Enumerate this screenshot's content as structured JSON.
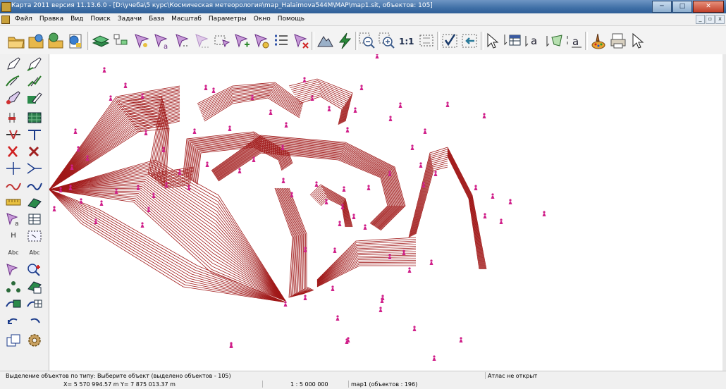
{
  "window": {
    "title": "Карта 2011 версия 11.13.6.0 - [D:\\учеба\\5 курс\\Космическая метеорология\\map_Halaimova544M\\MAP\\map1.sit, объектов: 105]",
    "min": "─",
    "max": "□",
    "close": "✕"
  },
  "menubar": {
    "items": [
      "Файл",
      "Правка",
      "Вид",
      "Поиск",
      "Задачи",
      "База",
      "Масштаб",
      "Параметры",
      "Окно",
      "Помощь"
    ],
    "mdi_min": "_",
    "mdi_max": "▫",
    "mdi_close": "x"
  },
  "toolbar": {
    "scale_button_label": "1:1",
    "label_a": "a",
    "label_a2": "a"
  },
  "lefttools": {
    "h_label": "H",
    "abc1": "Abc",
    "abc2": "Abc"
  },
  "map": {
    "contour_color": "#a01818",
    "marker_color": "#d0208a"
  },
  "status": {
    "message": "Выделение объектов по типу: Выберите объект (выделено объектов - 105)",
    "atlas": "Атлас не открыт",
    "coords": "X= 5 570 994.57 m    Y= 7 875 013.37 m",
    "scale": "1 : 5 000 000",
    "map_info": "map1   (объектов : 196)"
  }
}
